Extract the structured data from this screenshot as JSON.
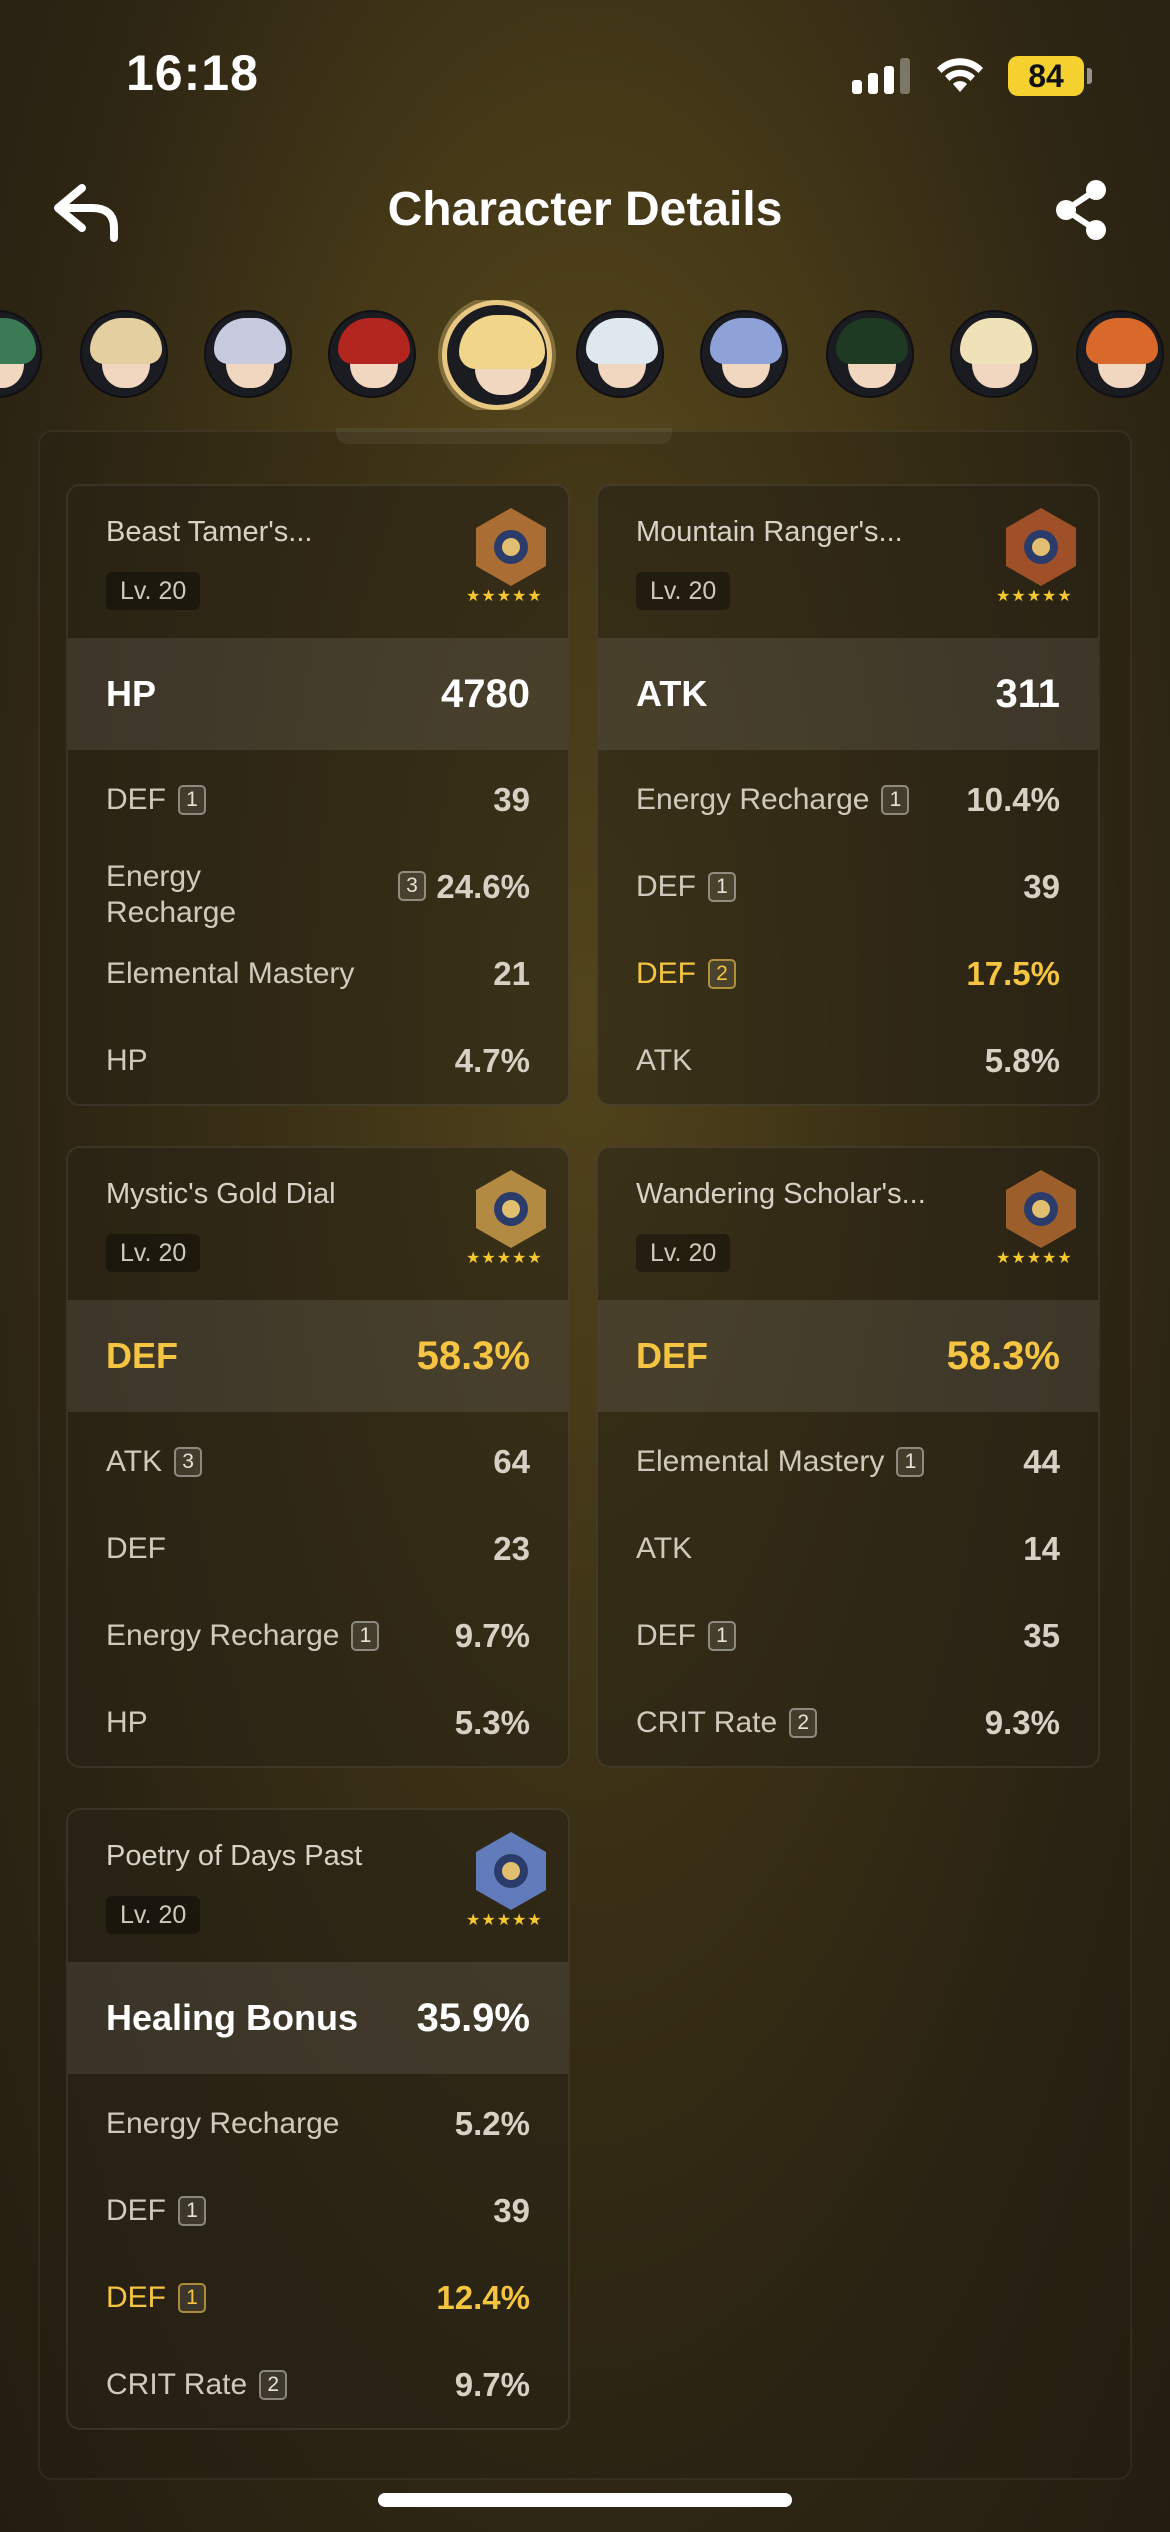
{
  "status_bar": {
    "time": "16:18",
    "battery": "84"
  },
  "header": {
    "title": "Character Details",
    "back_icon": "back-arrow-icon",
    "share_icon": "share-icon"
  },
  "characters": [
    {
      "name": "character-1",
      "hair": "#3a7a55"
    },
    {
      "name": "character-2",
      "hair": "#e4cfa0"
    },
    {
      "name": "character-3",
      "hair": "#c8cbe0"
    },
    {
      "name": "character-4",
      "hair": "#b3251f"
    },
    {
      "name": "character-5",
      "hair": "#f0d58a",
      "selected": true
    },
    {
      "name": "character-6",
      "hair": "#dfe7ef"
    },
    {
      "name": "character-7",
      "hair": "#8fa2d8"
    },
    {
      "name": "character-8",
      "hair": "#1f3a22"
    },
    {
      "name": "character-9",
      "hair": "#efe2b8"
    },
    {
      "name": "character-10",
      "hair": "#d8692b"
    }
  ],
  "artifacts": [
    {
      "name": "Beast Tamer's...",
      "level": "Lv. 20",
      "rarity": "★★★★★",
      "main_stat": {
        "label": "HP",
        "value": "4780",
        "highlight": false
      },
      "substats": [
        {
          "label": "DEF",
          "rolls": "1",
          "value": "39",
          "highlight": false
        },
        {
          "label": "Energy Recharge",
          "rolls": "3",
          "value": "24.6%",
          "highlight": false,
          "wrap": true
        },
        {
          "label": "Elemental Mastery",
          "rolls": "",
          "value": "21",
          "highlight": false
        },
        {
          "label": "HP",
          "rolls": "",
          "value": "4.7%",
          "highlight": false
        }
      ]
    },
    {
      "name": "Mountain Ranger's...",
      "level": "Lv. 20",
      "rarity": "★★★★★",
      "main_stat": {
        "label": "ATK",
        "value": "311",
        "highlight": false
      },
      "substats": [
        {
          "label": "Energy Recharge",
          "rolls": "1",
          "value": "10.4%",
          "highlight": false
        },
        {
          "label": "DEF",
          "rolls": "1",
          "value": "39",
          "highlight": false
        },
        {
          "label": "DEF",
          "rolls": "2",
          "value": "17.5%",
          "highlight": true
        },
        {
          "label": "ATK",
          "rolls": "",
          "value": "5.8%",
          "highlight": false
        }
      ]
    },
    {
      "name": "Mystic's Gold Dial",
      "level": "Lv. 20",
      "rarity": "★★★★★",
      "main_stat": {
        "label": "DEF",
        "value": "58.3%",
        "highlight": true
      },
      "substats": [
        {
          "label": "ATK",
          "rolls": "3",
          "value": "64",
          "highlight": false
        },
        {
          "label": "DEF",
          "rolls": "",
          "value": "23",
          "highlight": false
        },
        {
          "label": "Energy Recharge",
          "rolls": "1",
          "value": "9.7%",
          "highlight": false
        },
        {
          "label": "HP",
          "rolls": "",
          "value": "5.3%",
          "highlight": false
        }
      ]
    },
    {
      "name": "Wandering Scholar's...",
      "level": "Lv. 20",
      "rarity": "★★★★★",
      "main_stat": {
        "label": "DEF",
        "value": "58.3%",
        "highlight": true
      },
      "substats": [
        {
          "label": "Elemental Mastery",
          "rolls": "1",
          "value": "44",
          "highlight": false
        },
        {
          "label": "ATK",
          "rolls": "",
          "value": "14",
          "highlight": false
        },
        {
          "label": "DEF",
          "rolls": "1",
          "value": "35",
          "highlight": false
        },
        {
          "label": "CRIT Rate",
          "rolls": "2",
          "value": "9.3%",
          "highlight": false
        }
      ]
    },
    {
      "name": "Poetry of Days Past",
      "level": "Lv. 20",
      "rarity": "★★★★★",
      "main_stat": {
        "label": "Healing Bonus",
        "value": "35.9%",
        "highlight": false
      },
      "substats": [
        {
          "label": "Energy Recharge",
          "rolls": "",
          "value": "5.2%",
          "highlight": false
        },
        {
          "label": "DEF",
          "rolls": "1",
          "value": "39",
          "highlight": false
        },
        {
          "label": "DEF",
          "rolls": "1",
          "value": "12.4%",
          "highlight": true
        },
        {
          "label": "CRIT Rate",
          "rolls": "2",
          "value": "9.7%",
          "highlight": false
        }
      ]
    }
  ]
}
